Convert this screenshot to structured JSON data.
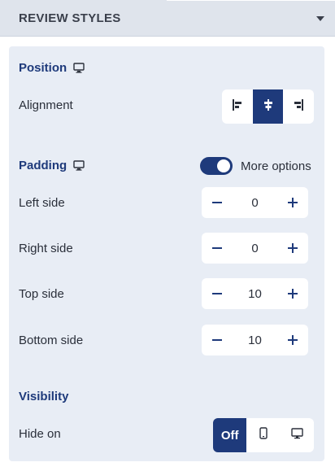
{
  "header": {
    "title": "REVIEW STYLES",
    "icon": "chevron-down-icon"
  },
  "position": {
    "title": "Position",
    "icon": "desktop-icon",
    "alignment": {
      "label": "Alignment",
      "options": [
        {
          "name": "left",
          "icon": "align-left-icon"
        },
        {
          "name": "center",
          "icon": "align-center-icon",
          "active": true
        },
        {
          "name": "right",
          "icon": "align-right-icon"
        }
      ]
    }
  },
  "padding": {
    "title": "Padding",
    "icon": "desktop-icon",
    "more_options": {
      "label": "More options",
      "enabled": true
    },
    "rows": [
      {
        "label": "Left side",
        "value": "0"
      },
      {
        "label": "Right side",
        "value": "0"
      },
      {
        "label": "Top side",
        "value": "10"
      },
      {
        "label": "Bottom side",
        "value": "10"
      }
    ]
  },
  "visibility": {
    "title": "Visibility",
    "hide_on": {
      "label": "Hide on",
      "options": [
        {
          "name": "off",
          "label": "Off",
          "active": true
        },
        {
          "name": "mobile",
          "icon": "mobile-icon"
        },
        {
          "name": "desktop",
          "icon": "desktop-icon"
        }
      ]
    }
  },
  "colors": {
    "accent": "#1e3a7b",
    "panel": "#e8edf5",
    "header": "#dfe4ec"
  }
}
